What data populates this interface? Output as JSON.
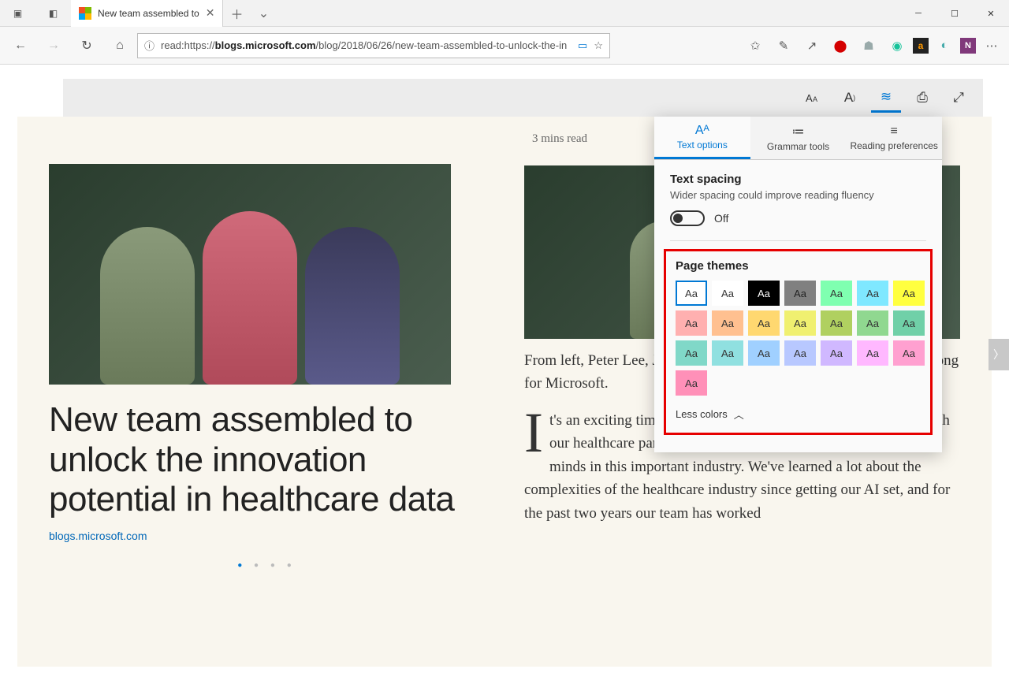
{
  "tab": {
    "title": "New team assembled to"
  },
  "url_prefix": "read:https://",
  "url_host": "blogs.microsoft.com",
  "url_path": "/blog/2018/06/26/new-team-assembled-to-unlock-the-in",
  "article": {
    "readtime": "3 mins read",
    "headline": "New team assembled to unlock the innovation potential in healthcare data",
    "source": "blogs.microsoft.com",
    "caption": "From left, Peter Lee, Jim Weinstein of Microsoft. Photo by Dan DeLong for Microsoft.",
    "body": "It's an exciting time at Microsoft working shoulder to shoulder with our healthcare partners — who represent some of the brightest minds in this important industry. We've learned a lot about the complexities of the healthcare industry since getting our AI set, and for the past two years our team has worked"
  },
  "panel": {
    "tabs": {
      "text_options": "Text options",
      "grammar": "Grammar tools",
      "reading": "Reading preferences"
    },
    "spacing": {
      "title": "Text spacing",
      "desc": "Wider spacing could improve reading fluency",
      "state": "Off"
    },
    "themes": {
      "title": "Page themes",
      "less": "Less colors",
      "swatches": [
        {
          "bg": "#ffffff",
          "fg": "#333",
          "sel": true
        },
        {
          "bg": "#ffffff",
          "fg": "#333"
        },
        {
          "bg": "#000000",
          "fg": "#fff"
        },
        {
          "bg": "#808080",
          "fg": "#222"
        },
        {
          "bg": "#7fffb0",
          "fg": "#333"
        },
        {
          "bg": "#7fe8ff",
          "fg": "#333"
        },
        {
          "bg": "#ffff3f",
          "fg": "#333"
        },
        {
          "bg": "#ffb0b0",
          "fg": "#333"
        },
        {
          "bg": "#ffc090",
          "fg": "#333"
        },
        {
          "bg": "#ffd870",
          "fg": "#333"
        },
        {
          "bg": "#f0f070",
          "fg": "#333"
        },
        {
          "bg": "#b0d060",
          "fg": "#333"
        },
        {
          "bg": "#90d890",
          "fg": "#333"
        },
        {
          "bg": "#70d0a8",
          "fg": "#333"
        },
        {
          "bg": "#80d8c8",
          "fg": "#333"
        },
        {
          "bg": "#90e0e0",
          "fg": "#333"
        },
        {
          "bg": "#a0d0ff",
          "fg": "#333"
        },
        {
          "bg": "#b8c8ff",
          "fg": "#333"
        },
        {
          "bg": "#d0b8ff",
          "fg": "#333"
        },
        {
          "bg": "#ffb8ff",
          "fg": "#333"
        },
        {
          "bg": "#ffa0d0",
          "fg": "#333"
        },
        {
          "bg": "#ff90b8",
          "fg": "#333"
        }
      ]
    }
  }
}
